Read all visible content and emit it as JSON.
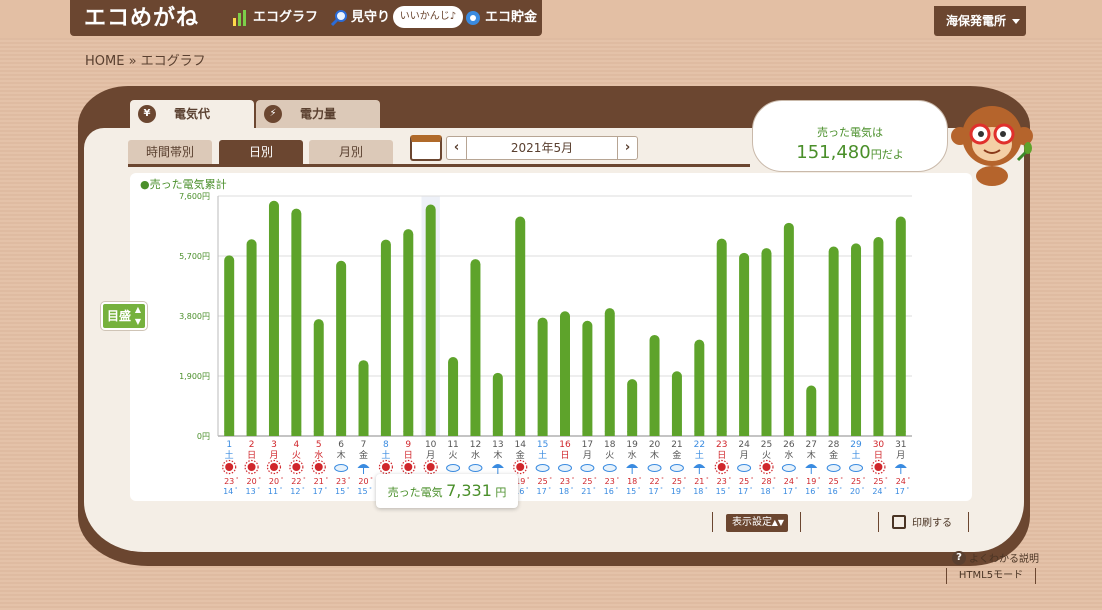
{
  "header": {
    "logo": "エコめがね",
    "nav": [
      {
        "label": "エコグラフ",
        "icon": "bar-chart-icon"
      },
      {
        "label": "見守り",
        "icon": "magnifier-icon"
      },
      {
        "label": "エコ貯金",
        "icon": "piggy-bank-icon"
      }
    ],
    "badge": "いいかんじ♪",
    "plant": "海保発電所"
  },
  "breadcrumb": "HOME » エコグラフ",
  "tabs": {
    "top": [
      "電気代",
      "電力量"
    ],
    "top_icons": [
      "¥",
      "⚡"
    ],
    "sub": [
      "時間帯別",
      "日別",
      "月別"
    ]
  },
  "date": {
    "label": "2021年5月",
    "prev": "‹",
    "next": "›"
  },
  "bubble": {
    "line1": "売った電気は",
    "amount": "151,480",
    "suffix": "円だよ"
  },
  "legend": "●売った電気累計",
  "gauge_button": "目盛",
  "tooltip": {
    "label": "売った電気",
    "value": "7,331",
    "unit": "円"
  },
  "footer": {
    "display_settings": "表示設定",
    "print": "印刷する",
    "help": "よくわかる説明",
    "html5": "HTML5モード"
  },
  "colors": {
    "bar": "#5ea32b",
    "brown": "#6b4630",
    "sunday": "#d0272c",
    "saturday": "#3a8be0",
    "weekday": "#555555"
  },
  "chart_data": {
    "type": "bar",
    "ylim": [
      0,
      7600
    ],
    "yticks": [
      "0円",
      "1,900円",
      "3,800円",
      "5,700円",
      "7,600円"
    ],
    "ytick_values": [
      0,
      1900,
      3800,
      5700,
      7600
    ],
    "categories": [
      "1",
      "2",
      "3",
      "4",
      "5",
      "6",
      "7",
      "8",
      "9",
      "10",
      "11",
      "12",
      "13",
      "14",
      "15",
      "16",
      "17",
      "18",
      "19",
      "20",
      "21",
      "22",
      "23",
      "24",
      "25",
      "26",
      "27",
      "28",
      "29",
      "30",
      "31"
    ],
    "weekdays": [
      "土",
      "日",
      "月",
      "火",
      "水",
      "木",
      "金",
      "土",
      "日",
      "月",
      "火",
      "水",
      "木",
      "金",
      "土",
      "日",
      "月",
      "火",
      "水",
      "木",
      "金",
      "土",
      "日",
      "月",
      "火",
      "水",
      "木",
      "金",
      "土",
      "日",
      "月"
    ],
    "day_colors": [
      "saturday",
      "sunday",
      "sunday",
      "sunday",
      "sunday",
      "weekday",
      "weekday",
      "saturday",
      "sunday",
      "weekday",
      "weekday",
      "weekday",
      "weekday",
      "weekday",
      "saturday",
      "sunday",
      "weekday",
      "weekday",
      "weekday",
      "weekday",
      "weekday",
      "saturday",
      "sunday",
      "weekday",
      "weekday",
      "weekday",
      "weekday",
      "weekday",
      "saturday",
      "sunday",
      "weekday"
    ],
    "weather": [
      "sun",
      "sun",
      "sun",
      "sun",
      "sun",
      "cloud",
      "rain",
      "sun",
      "sun",
      "sun",
      "cloud",
      "cloud",
      "rain",
      "sun",
      "cloud",
      "cloud",
      "cloud",
      "cloud",
      "rain",
      "cloud",
      "cloud",
      "rain",
      "sun",
      "cloud",
      "sun",
      "cloud",
      "rain",
      "cloud",
      "cloud",
      "sun",
      "rain"
    ],
    "temp_high": [
      "23",
      "20",
      "20",
      "22",
      "21",
      "23",
      "20",
      "23",
      "23",
      "20",
      "22",
      "22",
      "21",
      "19",
      "25",
      "23",
      "25",
      "23",
      "18",
      "22",
      "25",
      "21",
      "23",
      "25",
      "28",
      "24",
      "19",
      "25",
      "25",
      "25",
      "24"
    ],
    "temp_low": [
      "14",
      "13",
      "11",
      "12",
      "17",
      "15",
      "15",
      "14",
      "13",
      "14",
      "16",
      "15",
      "13",
      "16",
      "17",
      "18",
      "21",
      "16",
      "15",
      "17",
      "19",
      "18",
      "15",
      "17",
      "18",
      "17",
      "16",
      "16",
      "20",
      "24",
      "17"
    ],
    "values": [
      5720,
      6230,
      7450,
      7200,
      3700,
      5550,
      2400,
      6220,
      6550,
      7331,
      2500,
      5600,
      2000,
      6950,
      3750,
      3950,
      3650,
      4050,
      1800,
      3200,
      2050,
      3050,
      6250,
      5800,
      5950,
      6750,
      1600,
      6000,
      6100,
      6300,
      6950
    ],
    "highlight_index": 9
  }
}
